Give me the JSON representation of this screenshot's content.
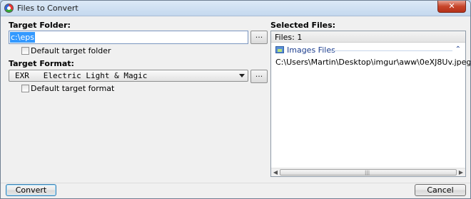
{
  "window": {
    "title": "Files to Convert",
    "close_glyph": "✕"
  },
  "left": {
    "target_folder_label": "Target Folder:",
    "target_folder_value": "c:\\eps",
    "browse_glyph": "...",
    "default_target_folder_label": "Default target folder",
    "target_format_label": "Target Format:",
    "target_format_value": "EXR   Electric Light & Magic",
    "default_target_format_label": "Default target format"
  },
  "right": {
    "selected_files_label": "Selected Files:",
    "files_count": "Files: 1",
    "group_label": "Images Files",
    "group_collapse_glyph": "⌃",
    "files": [
      "C:\\Users\\Martin\\Desktop\\imgur\\aww\\0eXJ8Uv.jpeg"
    ],
    "scroll_left_glyph": "◀",
    "scroll_right_glyph": "▶",
    "scroll_grip_glyph": "|||"
  },
  "buttons": {
    "convert": "Convert",
    "cancel": "Cancel"
  },
  "colors": {
    "selection": "#3399ff",
    "group_text": "#1e3f8f",
    "close": "#c7452a"
  }
}
